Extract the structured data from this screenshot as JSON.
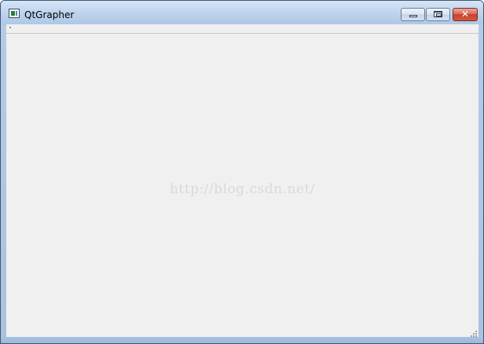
{
  "window": {
    "title": "QtGrapher",
    "icon": "app-window-icon",
    "controls": {
      "minimize": "minimize-icon",
      "maximize": "maximize-icon",
      "close": "close-icon",
      "close_glyph": "✕"
    }
  },
  "colors": {
    "client_background": "#f0f0f0",
    "titlebar": "#bcd2ec",
    "close_button": "#c7402b"
  },
  "content": {
    "watermark": "http://blog.csdn.net/"
  }
}
